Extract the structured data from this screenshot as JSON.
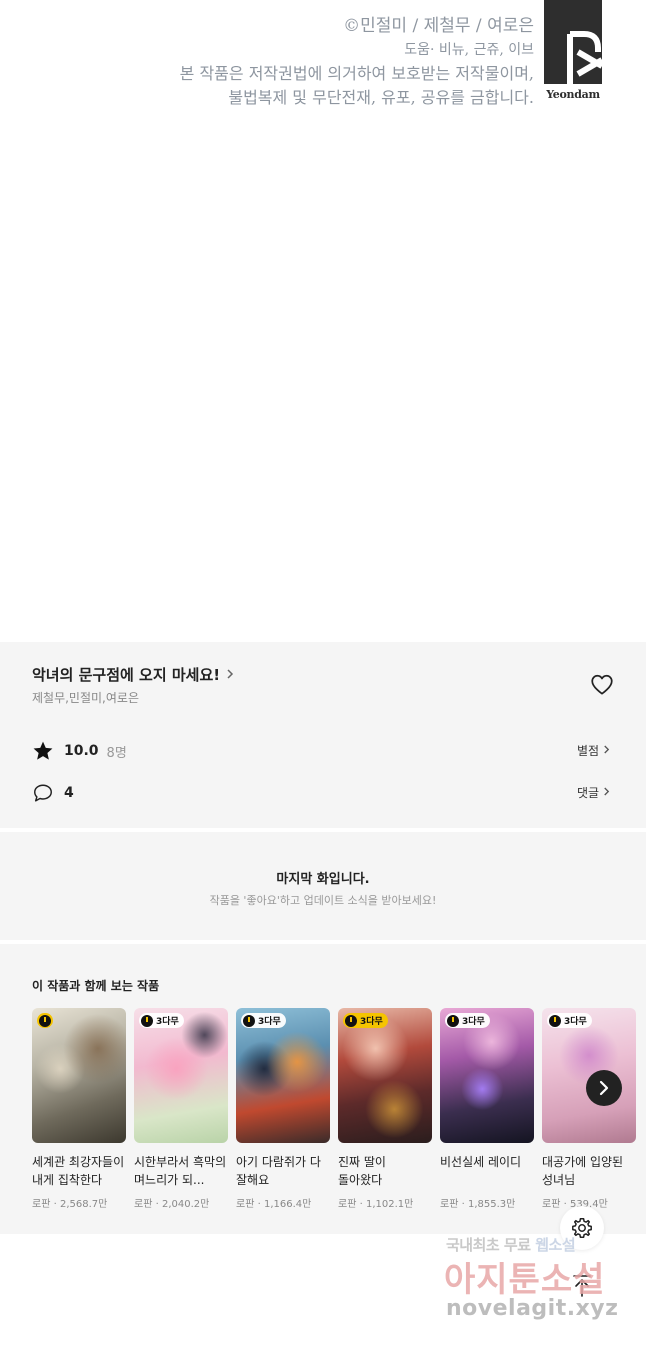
{
  "copyright": {
    "line1": "©민절미 / 제철무 / 여로은",
    "line2": "도움· 비뉴, 근쥬, 이브",
    "line3": "본 작품은 저작권법에 의거하여 보호받는 저작물이며,",
    "line4": "불법복제 및 무단전재, 유포, 공유를 금합니다.",
    "logo_text": "Yeondam"
  },
  "series": {
    "title": "악녀의 문구점에 오지 마세요!",
    "authors": "제철무,민절미,여로은",
    "rating": "10.0",
    "rating_count": "8명",
    "rating_link": "별점",
    "comment_count": "4",
    "comment_link": "댓글"
  },
  "last_episode": {
    "title": "마지막 화입니다.",
    "subtitle": "작품을 '좋아요'하고 업데이트 소식을 받아보세요!"
  },
  "recommendations": {
    "heading": "이 작품과 함께 보는 작품",
    "items": [
      {
        "title": "세계관 최강자들이 내게 집착한다",
        "genre": "로판",
        "views": "2,568.7만",
        "badge": ""
      },
      {
        "title": "시한부라서 흑막의 며느리가 되...",
        "genre": "로판",
        "views": "2,040.2만",
        "badge": "3다무"
      },
      {
        "title": "아기 다람쥐가 다 잘해요",
        "genre": "로판",
        "views": "1,166.4만",
        "badge": "3다무"
      },
      {
        "title": "진짜 딸이 돌아왔다",
        "genre": "로판",
        "views": "1,102.1만",
        "badge": "3다무"
      },
      {
        "title": "비선실세 레이디",
        "genre": "로판",
        "views": "1,855.3만",
        "badge": "3다무"
      },
      {
        "title": "대공가에 입양된 성녀님",
        "genre": "로판",
        "views": "539.4만",
        "badge": "3다무"
      }
    ],
    "separator": " · "
  },
  "watermark": {
    "line1a": "국내최초 무료 ",
    "line1b": "웹소설",
    "line2": "아지툰소설",
    "line3": "novelagit.xyz"
  },
  "colors": {
    "panel_bg": "#f5f5f5",
    "copyright_text": "#8e96a0",
    "badge_yellow": "#f5c400"
  }
}
